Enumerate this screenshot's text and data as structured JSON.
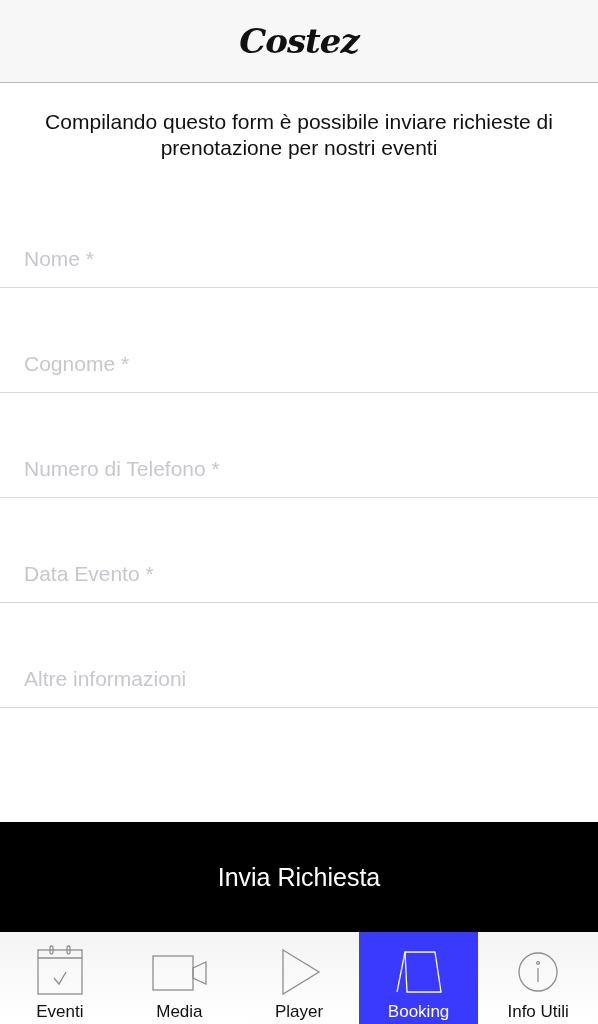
{
  "header": {
    "logo": "Costez"
  },
  "intro": "Compilando questo form è possibile inviare richieste di prenotazione per nostri eventi",
  "fields": [
    {
      "placeholder": "Nome *"
    },
    {
      "placeholder": "Cognome *"
    },
    {
      "placeholder": "Numero di Telefono *"
    },
    {
      "placeholder": "Data Evento *"
    },
    {
      "placeholder": "Altre informazioni"
    }
  ],
  "submit": "Invia Richiesta",
  "tabs": [
    {
      "label": "Eventi",
      "kind": "calendar",
      "selected": false
    },
    {
      "label": "Media",
      "kind": "video",
      "selected": false
    },
    {
      "label": "Player",
      "kind": "play",
      "selected": false
    },
    {
      "label": "Booking",
      "kind": "booking",
      "selected": true
    },
    {
      "label": "Info Utili",
      "kind": "info",
      "selected": false
    }
  ]
}
